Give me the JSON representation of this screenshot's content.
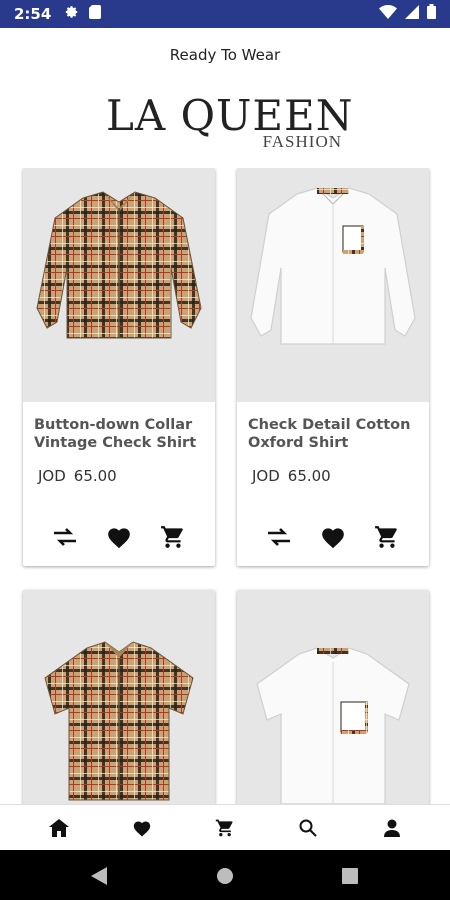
{
  "status_bar": {
    "time": "2:54",
    "left_icons": [
      "gear-icon",
      "sd-card-icon"
    ],
    "right_icons": [
      "wifi-icon",
      "signal-icon",
      "battery-icon"
    ],
    "background": "#293a8c"
  },
  "header": {
    "title": "Ready To Wear",
    "logo_main": "LA QUEEN",
    "logo_sub": "FASHION"
  },
  "products": [
    {
      "name": "Button-down Collar Vintage Check Shirt",
      "currency": "JOD",
      "price": "65.00",
      "image": "long-sleeve-check-shirt",
      "actions": [
        "compare-icon",
        "heart-icon",
        "cart-icon"
      ]
    },
    {
      "name": "Check Detail Cotton Oxford Shirt",
      "currency": "JOD",
      "price": "65.00",
      "image": "long-sleeve-white-shirt",
      "actions": [
        "compare-icon",
        "heart-icon",
        "cart-icon"
      ]
    },
    {
      "name": "",
      "currency": "",
      "price": "",
      "image": "short-sleeve-check-shirt"
    },
    {
      "name": "",
      "currency": "",
      "price": "",
      "image": "short-sleeve-white-shirt"
    }
  ],
  "bottom_nav": [
    "home-icon",
    "heart-icon",
    "cart-icon",
    "search-icon",
    "profile-icon"
  ],
  "system_nav": [
    "back-icon",
    "home-circle-icon",
    "recents-square-icon"
  ],
  "colors": {
    "check_tan": "#c9a473",
    "check_line": "#1b1b1b",
    "check_red": "#b8332a",
    "card_bg": "#e6e6e6"
  }
}
